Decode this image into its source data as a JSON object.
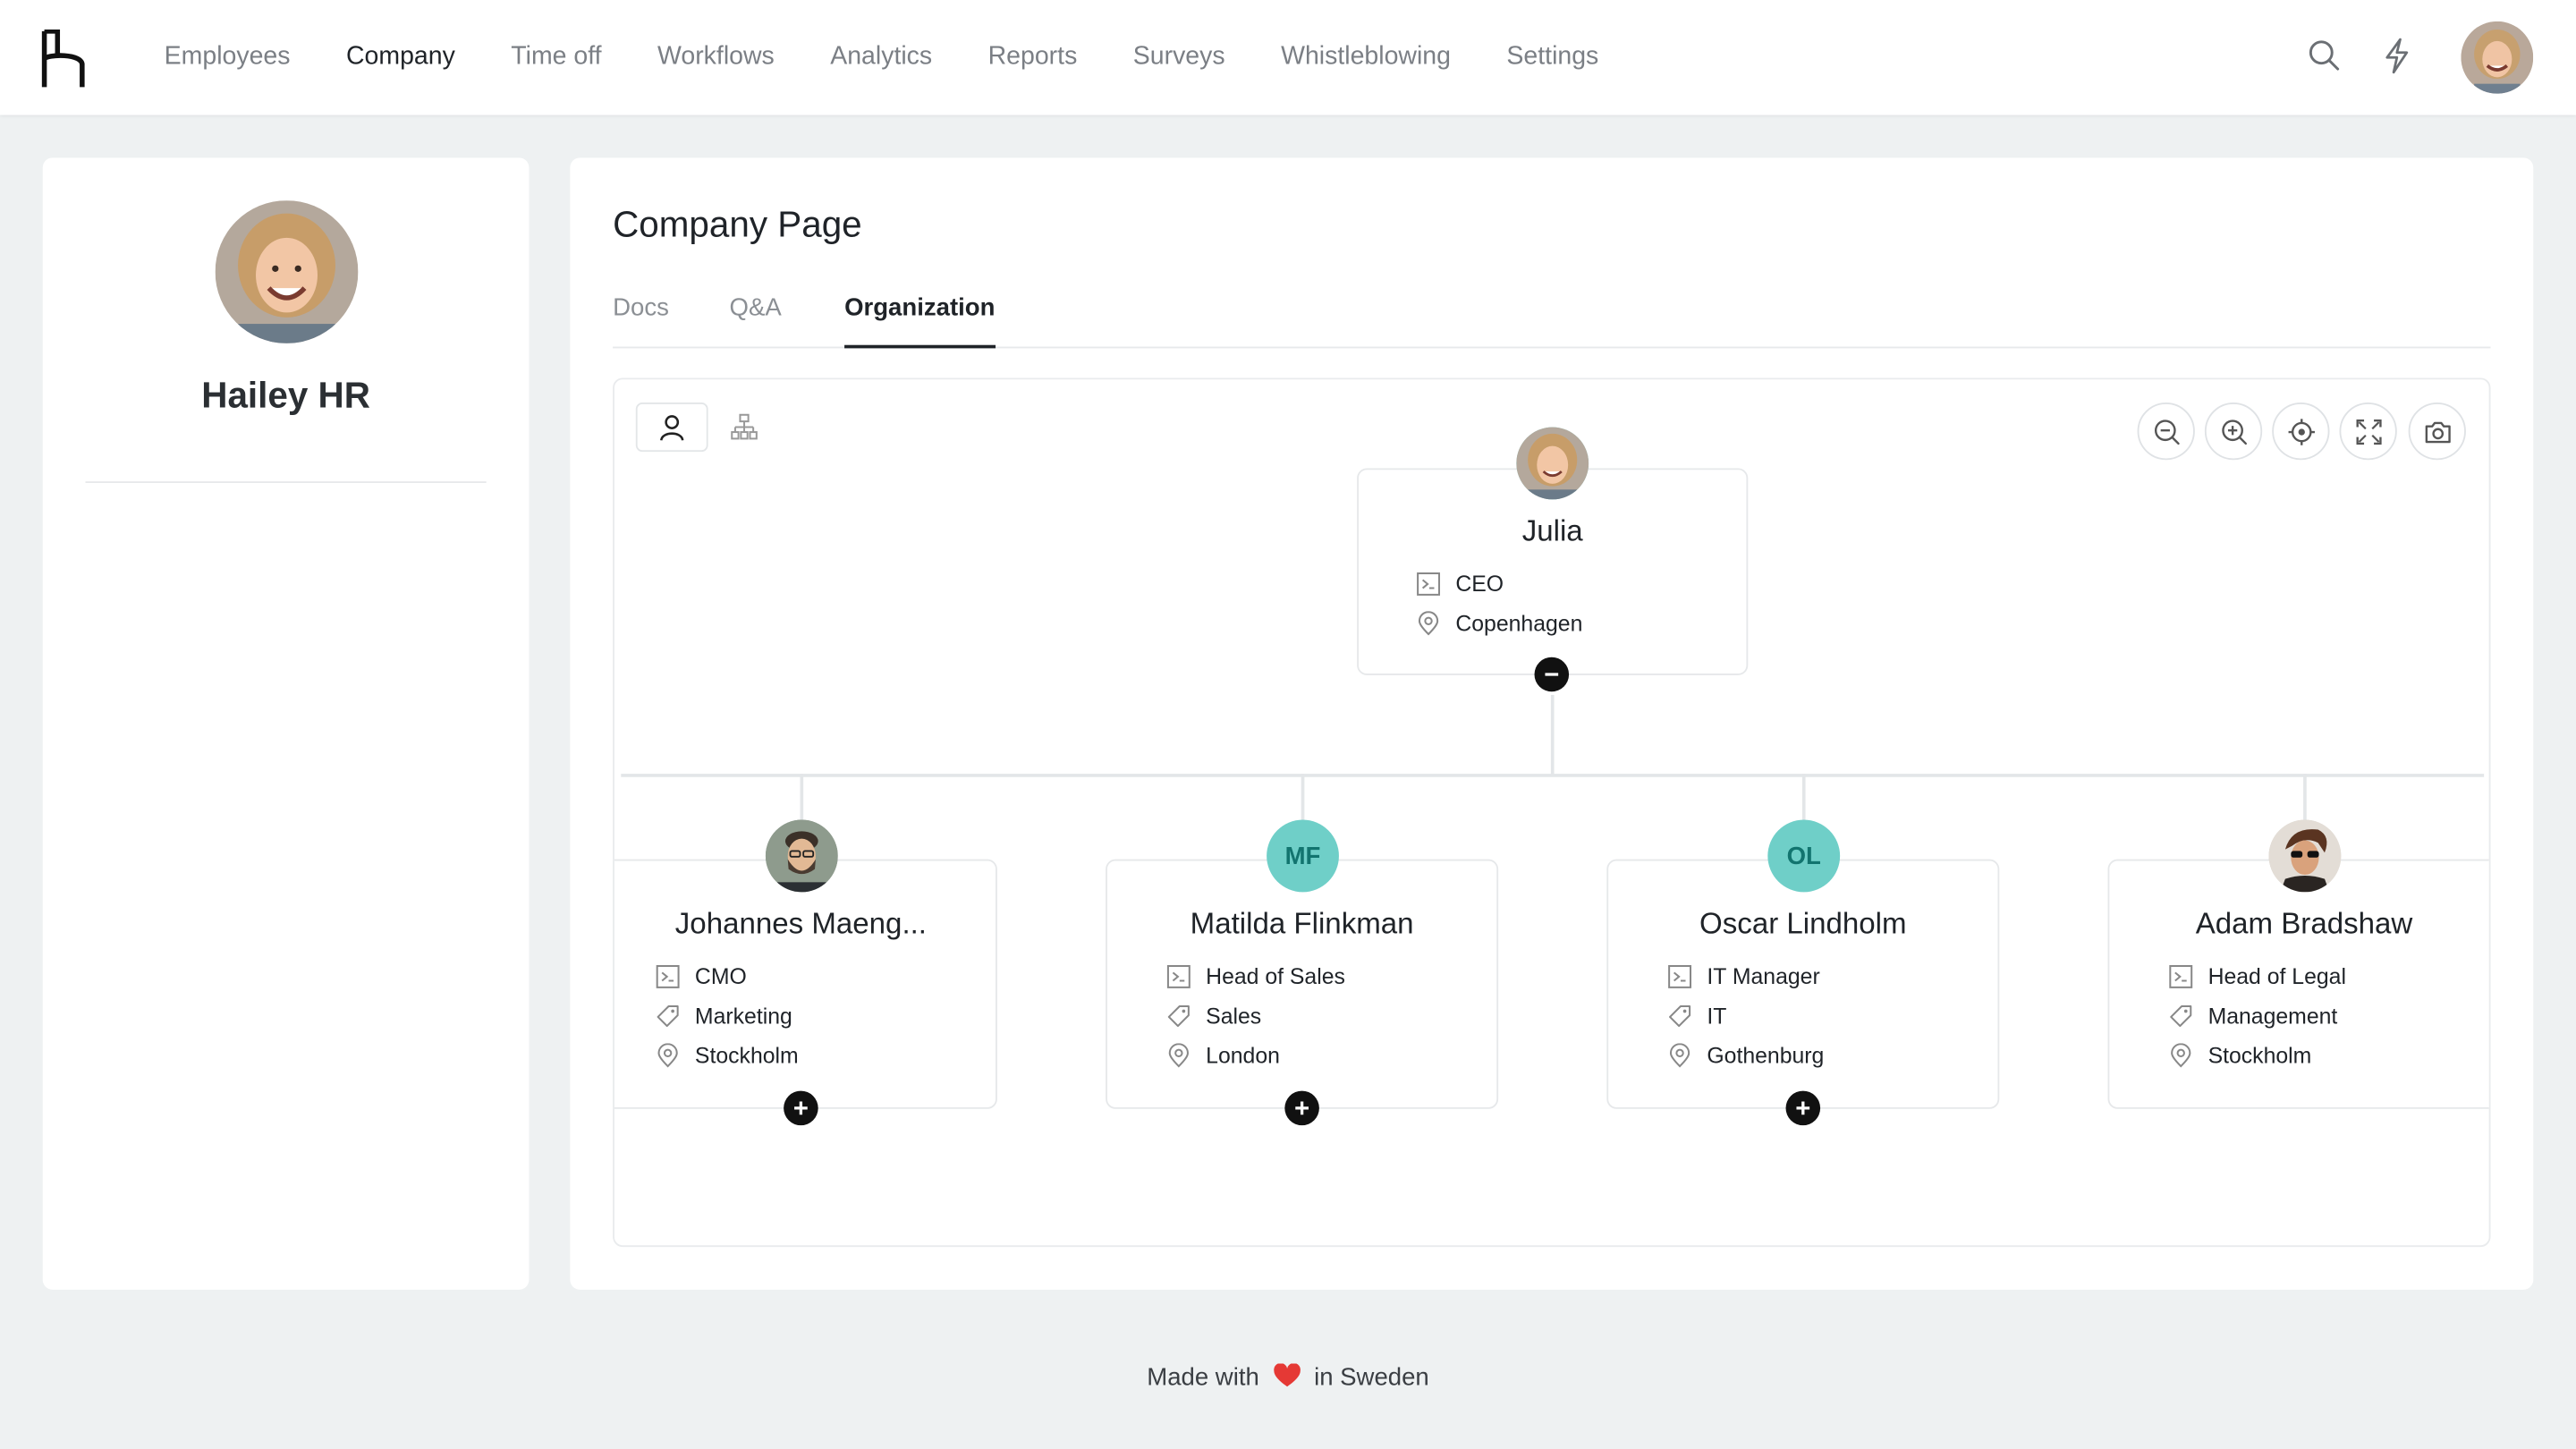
{
  "nav": {
    "items": [
      "Employees",
      "Company",
      "Time off",
      "Workflows",
      "Analytics",
      "Reports",
      "Surveys",
      "Whistleblowing",
      "Settings"
    ],
    "active": "Company"
  },
  "profile": {
    "name": "Hailey HR"
  },
  "page": {
    "title": "Company Page",
    "tabs": [
      "Docs",
      "Q&A",
      "Organization"
    ],
    "active_tab": "Organization"
  },
  "org": {
    "root": {
      "name": "Julia",
      "title": "CEO",
      "location": "Copenhagen"
    },
    "children": [
      {
        "name": "Johannes Maeng...",
        "title": "CMO",
        "department": "Marketing",
        "location": "Stockholm",
        "initials": ""
      },
      {
        "name": "Matilda Flinkman",
        "title": "Head of Sales",
        "department": "Sales",
        "location": "London",
        "initials": "MF"
      },
      {
        "name": "Oscar Lindholm",
        "title": "IT Manager",
        "department": "IT",
        "location": "Gothenburg",
        "initials": "OL"
      },
      {
        "name": "Adam Bradshaw",
        "title": "Head of Legal",
        "department": "Management",
        "location": "Stockholm",
        "initials": ""
      }
    ]
  },
  "footer": {
    "prefix": "Made with",
    "suffix": "in Sweden"
  },
  "colors": {
    "initials_bg": "#6fcfc8",
    "initials_text": "#12746f",
    "accent": "#1f2328"
  }
}
